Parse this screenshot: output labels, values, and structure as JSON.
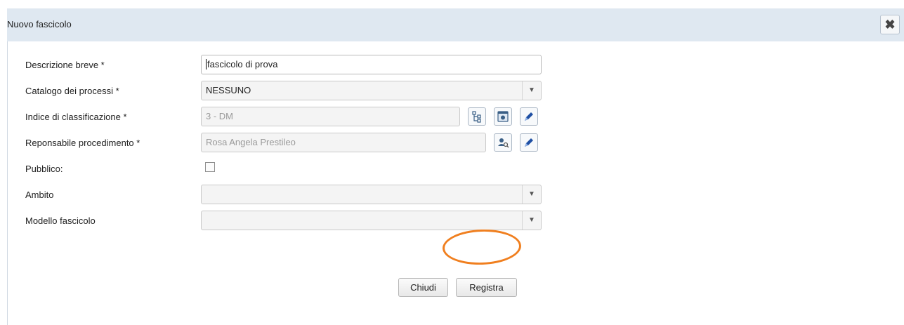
{
  "dialog": {
    "title": "Nuovo fascicolo",
    "close_icon": "close-icon"
  },
  "form": {
    "descrizione": {
      "label": "Descrizione breve *",
      "value": "fascicolo di prova"
    },
    "catalogo": {
      "label": "Catalogo dei processi *",
      "value": "NESSUNO"
    },
    "indice": {
      "label": "Indice di classificazione *",
      "value": "3 - DM",
      "icons": [
        "tree-icon",
        "browse-icon",
        "edit-icon"
      ]
    },
    "responsabile": {
      "label": "Reponsabile procedimento *",
      "value": "Rosa Angela Prestileo",
      "icons": [
        "user-search-icon",
        "edit-icon"
      ]
    },
    "pubblico": {
      "label": "Pubblico:",
      "checked": false
    },
    "ambito": {
      "label": "Ambito",
      "value": ""
    },
    "modello": {
      "label": "Modello fascicolo",
      "value": ""
    }
  },
  "buttons": {
    "close": "Chiudi",
    "save": "Registra"
  },
  "colors": {
    "titlebar": "#dfe8f1",
    "highlight": "#f07f1f"
  }
}
